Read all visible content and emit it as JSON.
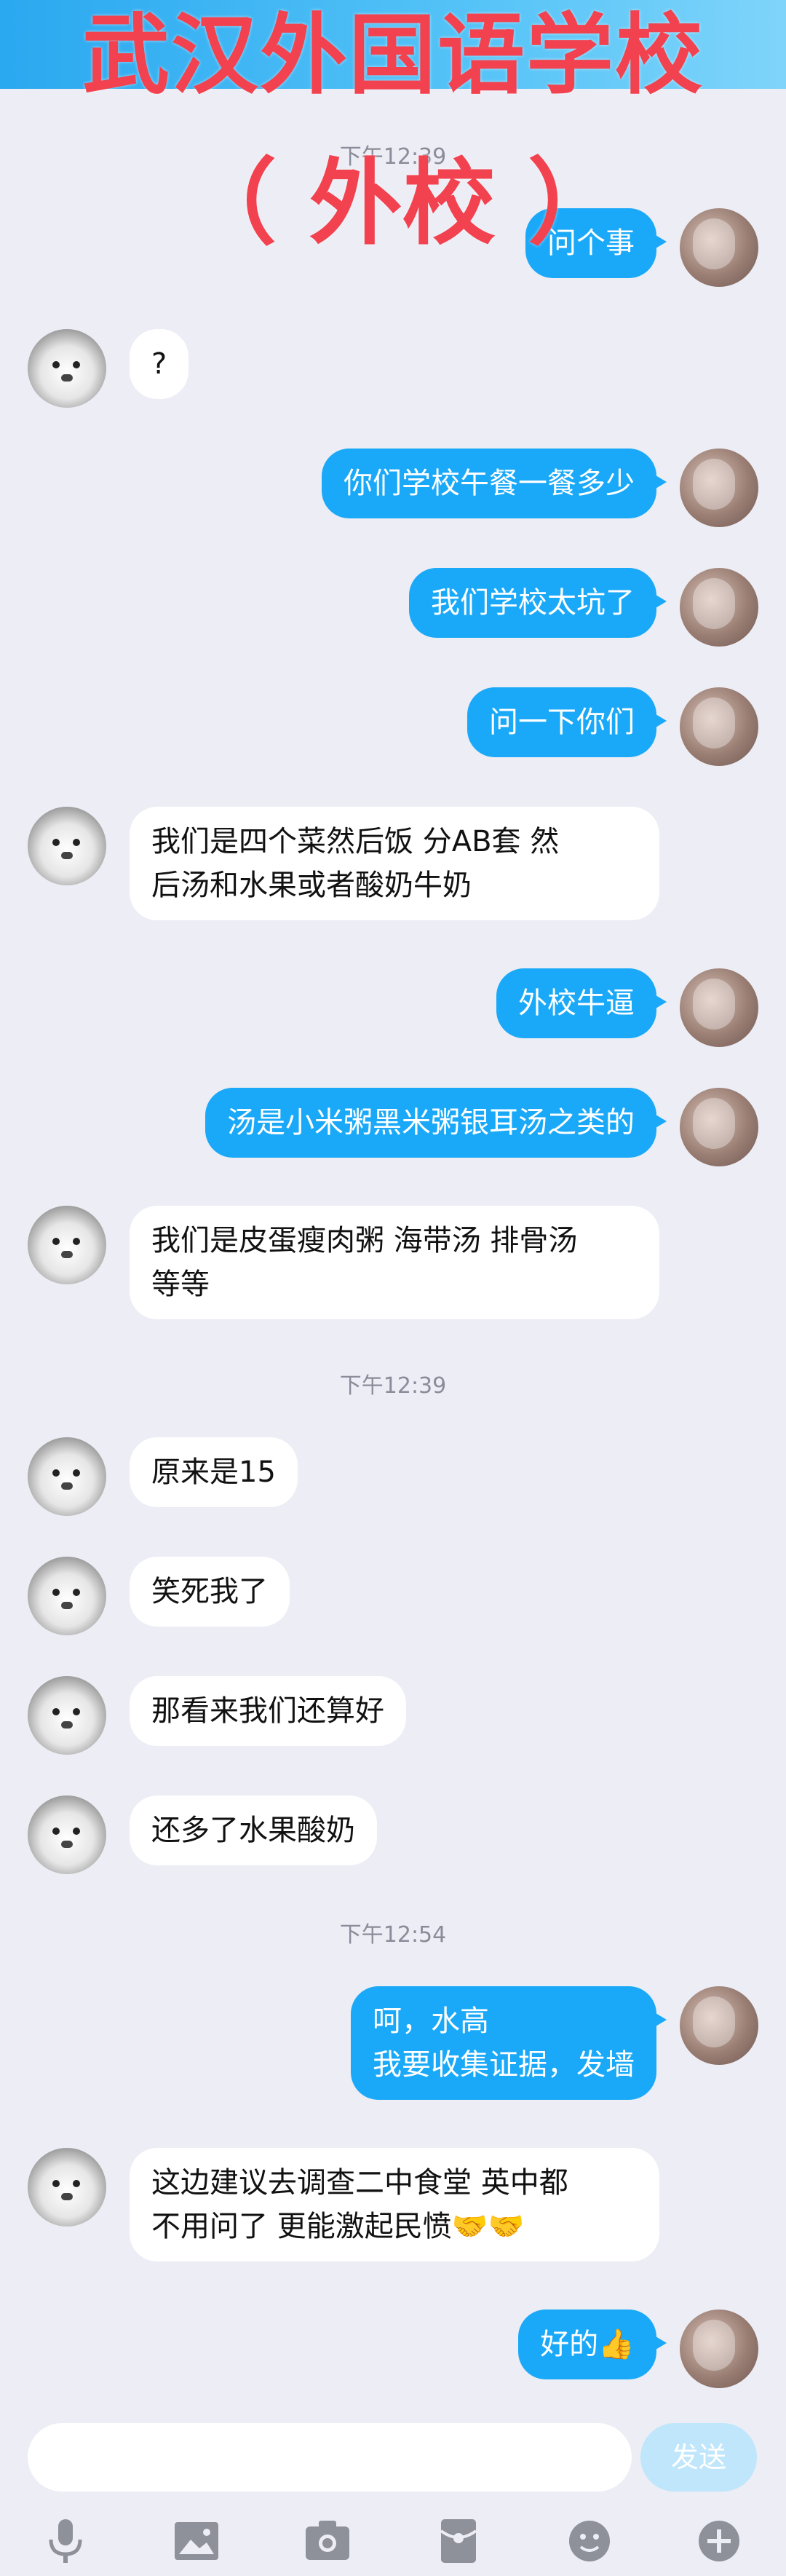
{
  "banner": {
    "line1": "武汉外国语学校",
    "line2": "（ 外校 ）"
  },
  "timestamps": [
    "下午12:39",
    "下午12:39",
    "下午12:54"
  ],
  "messages": [
    {
      "side": "me",
      "text": "问个事"
    },
    {
      "side": "peer",
      "text": "?"
    },
    {
      "side": "me",
      "text": "你们学校午餐一餐多少"
    },
    {
      "side": "me",
      "text": "我们学校太坑了"
    },
    {
      "side": "me",
      "text": "问一下你们"
    },
    {
      "side": "peer",
      "text": "我们是四个菜然后饭 分AB套 然\n后汤和水果或者酸奶牛奶"
    },
    {
      "side": "me",
      "text": "外校牛逼"
    },
    {
      "side": "me",
      "text": "汤是小米粥黑米粥银耳汤之类的"
    },
    {
      "side": "peer",
      "text": "我们是皮蛋瘦肉粥 海带汤 排骨汤\n等等"
    },
    {
      "side": "peer",
      "text": "原来是15"
    },
    {
      "side": "peer",
      "text": "笑死我了"
    },
    {
      "side": "peer",
      "text": "那看来我们还算好"
    },
    {
      "side": "peer",
      "text": "还多了水果酸奶"
    },
    {
      "side": "me",
      "text": "呵，水高\n我要收集证据，发墙"
    },
    {
      "side": "peer",
      "text": "这边建议去调查二中食堂 英中都\n不用问了 更能激起民愤🤝🤝"
    },
    {
      "side": "me",
      "text": "好的👍"
    }
  ],
  "composer": {
    "placeholder": "",
    "send_label": "发送"
  },
  "toolbar": {
    "icons": [
      "microphone-icon",
      "image-icon",
      "camera-icon",
      "red-packet-icon",
      "emoji-icon",
      "plus-icon"
    ]
  },
  "colors": {
    "my_bubble": "#1aa9f8",
    "peer_bubble": "#ffffff",
    "background": "#ecedf5",
    "banner_text": "#f2424f"
  }
}
